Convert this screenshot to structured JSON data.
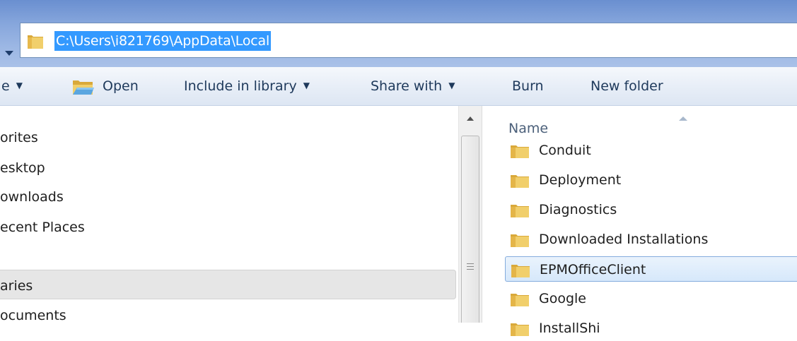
{
  "address": {
    "path": "C:\\Users\\i821769\\AppData\\Local"
  },
  "toolbar": {
    "organize_label": "e",
    "open_label": "Open",
    "include_label": "Include in library",
    "share_label": "Share with",
    "burn_label": "Burn",
    "new_folder_label": "New folder"
  },
  "nav": {
    "favorites": "orites",
    "desktop": "esktop",
    "downloads": "ownloads",
    "recent": "ecent Places",
    "libraries": "aries",
    "documents": "ocuments"
  },
  "content": {
    "column_name": "Name",
    "items": [
      {
        "name": "Conduit"
      },
      {
        "name": "Deployment"
      },
      {
        "name": "Diagnostics"
      },
      {
        "name": "Downloaded Installations"
      },
      {
        "name": "EPMOfficeClient"
      },
      {
        "name": "Google"
      },
      {
        "name": "InstallShi"
      }
    ],
    "selected_index": 4
  },
  "colors": {
    "selection_blue": "#3399ff",
    "folder_yellow": "#e8c15a"
  }
}
